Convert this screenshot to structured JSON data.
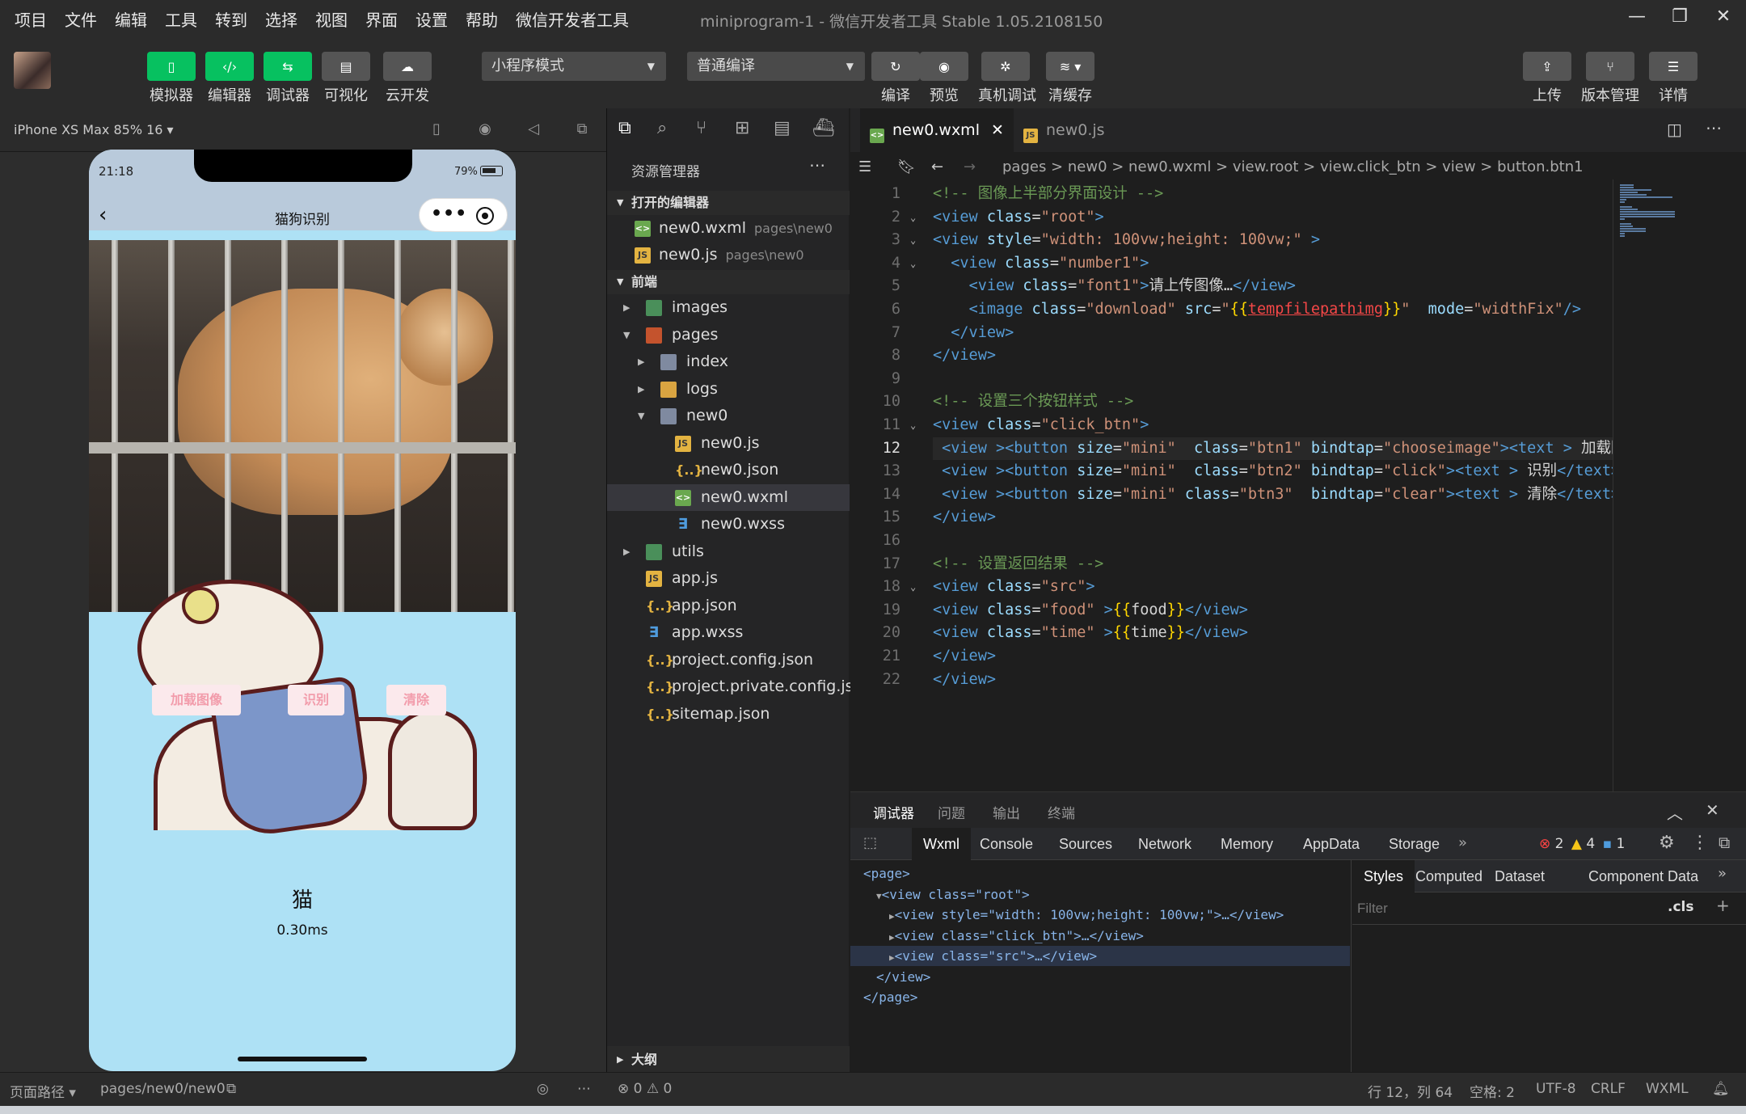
{
  "menu": [
    "项目",
    "文件",
    "编辑",
    "工具",
    "转到",
    "选择",
    "视图",
    "界面",
    "设置",
    "帮助",
    "微信开发者工具"
  ],
  "window_title": "miniprogram-1 - 微信开发者工具 Stable 1.05.2108150",
  "toolbar": {
    "simulator": "模拟器",
    "editor": "编辑器",
    "debugger": "调试器",
    "visual": "可视化",
    "cloud": "云开发",
    "mode": "小程序模式",
    "compile_mode": "普通编译",
    "compile": "编译",
    "preview": "预览",
    "remote_debug": "真机调试",
    "clear_cache": "清缓存",
    "upload": "上传",
    "version": "版本管理",
    "details": "详情"
  },
  "simulator": {
    "device": "iPhone XS Max 85% 16 ▾",
    "time": "21:18",
    "battery": "79%",
    "page_title": "猫狗识别",
    "btn_load": "加载图像",
    "btn_recognize": "识别",
    "btn_clear": "清除",
    "result": "猫",
    "elapsed": "0.30ms",
    "footer_label": "页面路径 ▾",
    "footer_path": "pages/new0/new0"
  },
  "explorer": {
    "title": "资源管理器",
    "open_editors": "打开的编辑器",
    "open_files": [
      {
        "name": "new0.wxml",
        "path": "pages\\new0",
        "type": "wxml"
      },
      {
        "name": "new0.js",
        "path": "pages\\new0",
        "type": "js"
      }
    ],
    "project": "前端",
    "tree": [
      {
        "name": "images",
        "depth": 1,
        "type": "folder4",
        "arrow": "▸"
      },
      {
        "name": "pages",
        "depth": 1,
        "type": "folder3",
        "arrow": "▾"
      },
      {
        "name": "index",
        "depth": 2,
        "type": "folder",
        "arrow": "▸"
      },
      {
        "name": "logs",
        "depth": 2,
        "type": "folder2",
        "arrow": "▸"
      },
      {
        "name": "new0",
        "depth": 2,
        "type": "folder",
        "arrow": "▾"
      },
      {
        "name": "new0.js",
        "depth": 3,
        "type": "js"
      },
      {
        "name": "new0.json",
        "depth": 3,
        "type": "json"
      },
      {
        "name": "new0.wxml",
        "depth": 3,
        "type": "wxml",
        "selected": true
      },
      {
        "name": "new0.wxss",
        "depth": 3,
        "type": "wxss"
      },
      {
        "name": "utils",
        "depth": 1,
        "type": "folder4",
        "arrow": "▸"
      },
      {
        "name": "app.js",
        "depth": 1,
        "type": "js"
      },
      {
        "name": "app.json",
        "depth": 1,
        "type": "json"
      },
      {
        "name": "app.wxss",
        "depth": 1,
        "type": "wxss"
      },
      {
        "name": "project.config.json",
        "depth": 1,
        "type": "json"
      },
      {
        "name": "project.private.config.js...",
        "depth": 1,
        "type": "json"
      },
      {
        "name": "sitemap.json",
        "depth": 1,
        "type": "json"
      }
    ],
    "outline": "大纲",
    "problems": "⊗ 0 ⚠ 0"
  },
  "editor": {
    "tabs": [
      {
        "name": "new0.wxml",
        "active": true
      },
      {
        "name": "new0.js",
        "active": false
      }
    ],
    "breadcrumb": "pages > new0 > new0.wxml > view.root > view.click_btn > view > button.btn1",
    "current_line": 12,
    "lines": [
      [
        [
          "c-cm",
          "<!-- 图像上半部分界面设计 -->"
        ]
      ],
      [
        [
          "c-tg",
          "<view "
        ],
        [
          "c-at",
          "class"
        ],
        [
          "c-tx",
          "="
        ],
        [
          "c-st",
          "\"root\""
        ],
        [
          "c-tg",
          ">"
        ]
      ],
      [
        [
          "c-tg",
          "<view "
        ],
        [
          "c-at",
          "style"
        ],
        [
          "c-tx",
          "="
        ],
        [
          "c-st",
          "\"width: 100vw;height: 100vw;\""
        ],
        [
          "c-tg",
          " >"
        ]
      ],
      [
        [
          "c-tx",
          "  "
        ],
        [
          "c-tg",
          "<view "
        ],
        [
          "c-at",
          "class"
        ],
        [
          "c-tx",
          "="
        ],
        [
          "c-st",
          "\"number1\""
        ],
        [
          "c-tg",
          ">"
        ]
      ],
      [
        [
          "c-tx",
          "    "
        ],
        [
          "c-tg",
          "<view "
        ],
        [
          "c-at",
          "class"
        ],
        [
          "c-tx",
          "="
        ],
        [
          "c-st",
          "\"font1\""
        ],
        [
          "c-tg",
          ">"
        ],
        [
          "c-tx",
          "请上传图像…"
        ],
        [
          "c-tg",
          "</view>"
        ]
      ],
      [
        [
          "c-tx",
          "    "
        ],
        [
          "c-tg",
          "<image "
        ],
        [
          "c-at",
          "class"
        ],
        [
          "c-tx",
          "="
        ],
        [
          "c-st",
          "\"download\""
        ],
        [
          "c-tx",
          " "
        ],
        [
          "c-at",
          "src"
        ],
        [
          "c-tx",
          "="
        ],
        [
          "c-st",
          "\""
        ],
        [
          "c-br",
          "{{"
        ],
        [
          "c-ex",
          "tempfilepathimg"
        ],
        [
          "c-br",
          "}}"
        ],
        [
          "c-st",
          "\""
        ],
        [
          "c-tx",
          "  "
        ],
        [
          "c-at",
          "mode"
        ],
        [
          "c-tx",
          "="
        ],
        [
          "c-st",
          "\"widthFix\""
        ],
        [
          "c-tg",
          "/>"
        ]
      ],
      [
        [
          "c-tx",
          "  "
        ],
        [
          "c-tg",
          "</view>"
        ]
      ],
      [
        [
          "c-tg",
          "</view>"
        ]
      ],
      [],
      [
        [
          "c-cm",
          "<!-- 设置三个按钮样式 -->"
        ]
      ],
      [
        [
          "c-tg",
          "<view "
        ],
        [
          "c-at",
          "class"
        ],
        [
          "c-tx",
          "="
        ],
        [
          "c-st",
          "\"click_btn\""
        ],
        [
          "c-tg",
          ">"
        ]
      ],
      [
        [
          "c-tx",
          " "
        ],
        [
          "c-tg",
          "<view >"
        ],
        [
          "c-tg",
          "<button "
        ],
        [
          "c-at",
          "size"
        ],
        [
          "c-tx",
          "="
        ],
        [
          "c-st",
          "\"mini\""
        ],
        [
          "c-tx",
          "  "
        ],
        [
          "c-at",
          "class"
        ],
        [
          "c-tx",
          "="
        ],
        [
          "c-st",
          "\"btn1\""
        ],
        [
          "c-tx",
          " "
        ],
        [
          "c-at",
          "bindtap"
        ],
        [
          "c-tx",
          "="
        ],
        [
          "c-st",
          "\"chooseimage\""
        ],
        [
          "c-tg",
          ">"
        ],
        [
          "c-tg",
          "<text >"
        ],
        [
          "c-tx",
          " 加载图"
        ]
      ],
      [
        [
          "c-tx",
          " "
        ],
        [
          "c-tg",
          "<view >"
        ],
        [
          "c-tg",
          "<button "
        ],
        [
          "c-at",
          "size"
        ],
        [
          "c-tx",
          "="
        ],
        [
          "c-st",
          "\"mini\""
        ],
        [
          "c-tx",
          "  "
        ],
        [
          "c-at",
          "class"
        ],
        [
          "c-tx",
          "="
        ],
        [
          "c-st",
          "\"btn2\""
        ],
        [
          "c-tx",
          " "
        ],
        [
          "c-at",
          "bindtap"
        ],
        [
          "c-tx",
          "="
        ],
        [
          "c-st",
          "\"click\""
        ],
        [
          "c-tg",
          ">"
        ],
        [
          "c-tg",
          "<text >"
        ],
        [
          "c-tx",
          " 识别"
        ],
        [
          "c-tg",
          "</text>"
        ]
      ],
      [
        [
          "c-tx",
          " "
        ],
        [
          "c-tg",
          "<view >"
        ],
        [
          "c-tg",
          "<button "
        ],
        [
          "c-at",
          "size"
        ],
        [
          "c-tx",
          "="
        ],
        [
          "c-st",
          "\"mini\""
        ],
        [
          "c-tx",
          " "
        ],
        [
          "c-at",
          "class"
        ],
        [
          "c-tx",
          "="
        ],
        [
          "c-st",
          "\"btn3\""
        ],
        [
          "c-tx",
          "  "
        ],
        [
          "c-at",
          "bindtap"
        ],
        [
          "c-tx",
          "="
        ],
        [
          "c-st",
          "\"clear\""
        ],
        [
          "c-tg",
          ">"
        ],
        [
          "c-tg",
          "<text >"
        ],
        [
          "c-tx",
          " 清除"
        ],
        [
          "c-tg",
          "</text>"
        ]
      ],
      [
        [
          "c-tg",
          "</view>"
        ]
      ],
      [],
      [
        [
          "c-cm",
          "<!-- 设置返回结果 -->"
        ]
      ],
      [
        [
          "c-tg",
          "<view "
        ],
        [
          "c-at",
          "class"
        ],
        [
          "c-tx",
          "="
        ],
        [
          "c-st",
          "\"src\""
        ],
        [
          "c-tg",
          ">"
        ]
      ],
      [
        [
          "c-tg",
          "<view "
        ],
        [
          "c-at",
          "class"
        ],
        [
          "c-tx",
          "="
        ],
        [
          "c-st",
          "\"food\""
        ],
        [
          "c-tx",
          " "
        ],
        [
          "c-tg",
          ">"
        ],
        [
          "c-br",
          "{{"
        ],
        [
          "c-tx",
          "food"
        ],
        [
          "c-br",
          "}}"
        ],
        [
          "c-tg",
          "</view>"
        ]
      ],
      [
        [
          "c-tg",
          "<view "
        ],
        [
          "c-at",
          "class"
        ],
        [
          "c-tx",
          "="
        ],
        [
          "c-st",
          "\"time\""
        ],
        [
          "c-tx",
          " "
        ],
        [
          "c-tg",
          ">"
        ],
        [
          "c-br",
          "{{"
        ],
        [
          "c-tx",
          "time"
        ],
        [
          "c-br",
          "}}"
        ],
        [
          "c-tg",
          "</view>"
        ]
      ],
      [
        [
          "c-tg",
          "</view>"
        ]
      ],
      [
        [
          "c-tg",
          "</view>"
        ]
      ]
    ],
    "fold_lines": [
      2,
      3,
      4,
      11,
      18
    ]
  },
  "debug": {
    "tabs": [
      "调试器",
      "问题",
      "输出",
      "终端"
    ],
    "devtools_tabs": [
      "Wxml",
      "Console",
      "Sources",
      "Network",
      "Memory",
      "AppData",
      "Storage"
    ],
    "errors": "2",
    "warnings": "4",
    "infos": "1",
    "dom": [
      {
        "text": "<page>",
        "indent": 0,
        "arrow": ""
      },
      {
        "text": "<view class=\"root\">",
        "indent": 1,
        "arrow": "▾"
      },
      {
        "text": "<view style=\"width: 100vw;height: 100vw;\">…</view>",
        "indent": 2,
        "arrow": "▸"
      },
      {
        "text": "<view class=\"click_btn\">…</view>",
        "indent": 2,
        "arrow": "▸"
      },
      {
        "text": "<view class=\"src\">…</view>",
        "indent": 2,
        "arrow": "▸",
        "selected": true
      },
      {
        "text": "</view>",
        "indent": 1,
        "arrow": ""
      },
      {
        "text": "</page>",
        "indent": 0,
        "arrow": ""
      }
    ],
    "styles_tabs": [
      "Styles",
      "Computed",
      "Dataset",
      "Component Data"
    ],
    "filter_placeholder": "Filter",
    "cls": ".cls"
  },
  "status": {
    "position": "行 12，列 64",
    "spaces": "空格: 2",
    "encoding": "UTF-8",
    "eol": "CRLF",
    "language": "WXML"
  }
}
